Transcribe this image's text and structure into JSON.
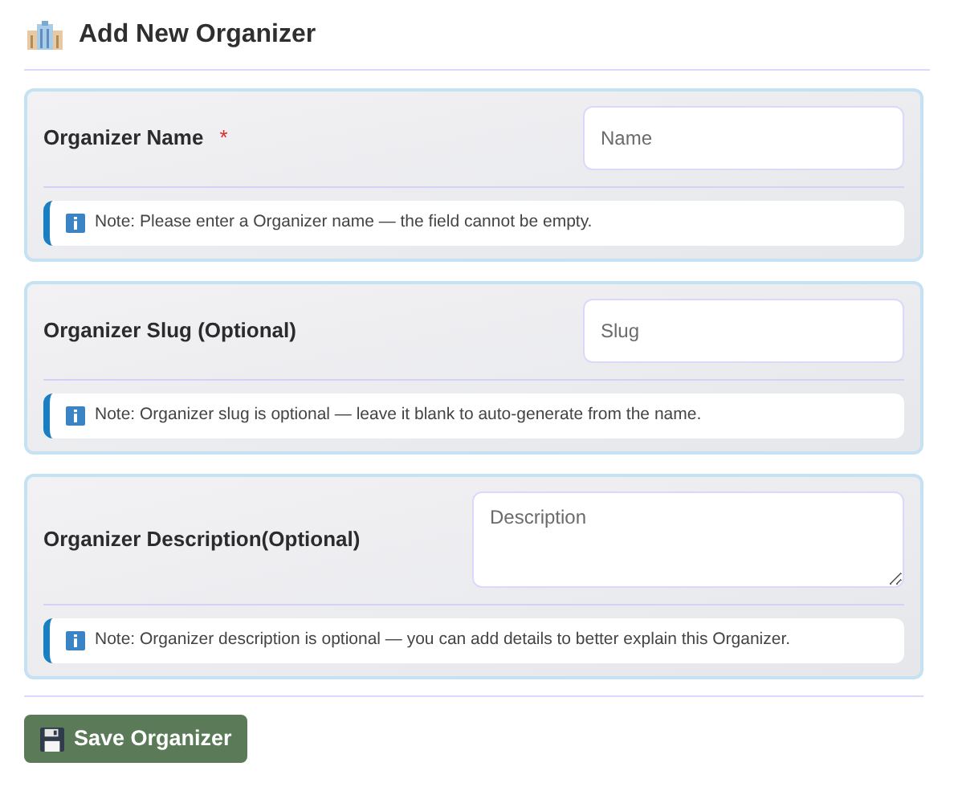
{
  "title": "Add New Organizer",
  "fields": [
    {
      "label": "Organizer Name",
      "required": true,
      "kind": "input",
      "placeholder": "Name",
      "note": "Note: Please enter a Organizer name — the field cannot be empty."
    },
    {
      "label": "Organizer Slug (Optional)",
      "required": false,
      "kind": "input",
      "placeholder": "Slug",
      "note": "Note: Organizer slug is optional — leave it blank to auto-generate from the name."
    },
    {
      "label": "Organizer Description(Optional)",
      "required": false,
      "kind": "textarea",
      "placeholder": "Description",
      "note": "Note: Organizer description is optional — you can add details to better explain this Organizer."
    }
  ],
  "required_mark": "*",
  "save_button": "Save Organizer"
}
